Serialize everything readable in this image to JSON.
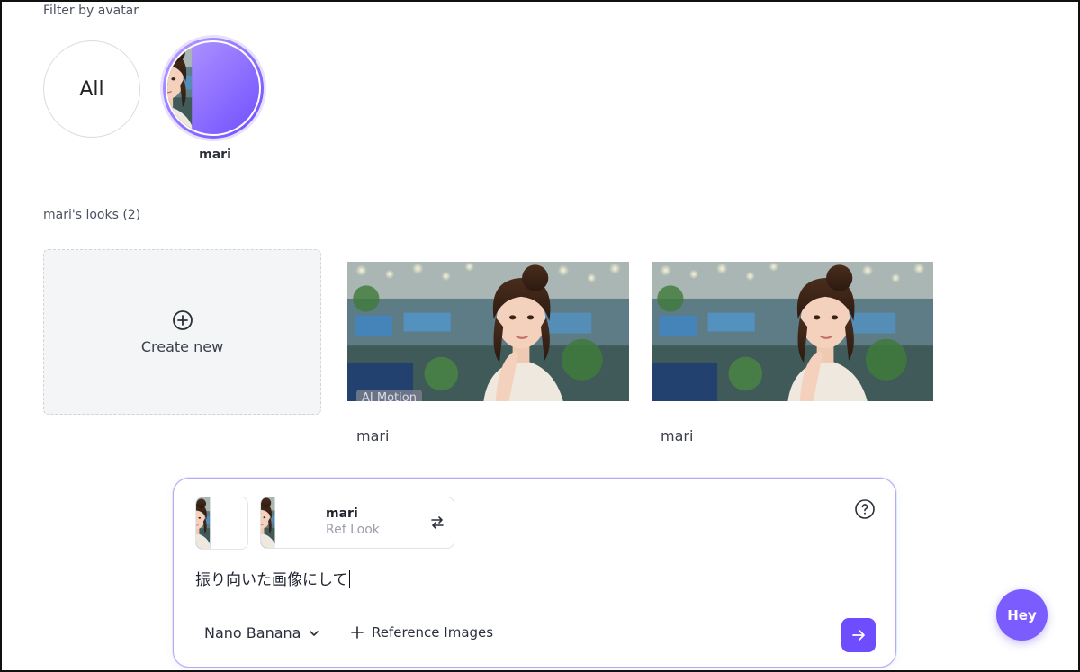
{
  "filter": {
    "label": "Filter by avatar",
    "all_label": "All",
    "avatar_name": "mari"
  },
  "looks": {
    "heading": "mari's looks (2)",
    "create_label": "Create new",
    "items": [
      {
        "name": "mari",
        "badge": "AI Motion"
      },
      {
        "name": "mari",
        "badge": ""
      }
    ]
  },
  "composer": {
    "ref_chip": {
      "name": "mari",
      "subtitle": "Ref Look"
    },
    "prompt_text": "振り向いた画像にして",
    "model": "Nano Banana",
    "reference_images_label": "Reference Images"
  },
  "chat_widget": {
    "label": "Hey"
  },
  "colors": {
    "accent": "#6e4dff",
    "avatar_ring": "#7b5cff"
  }
}
